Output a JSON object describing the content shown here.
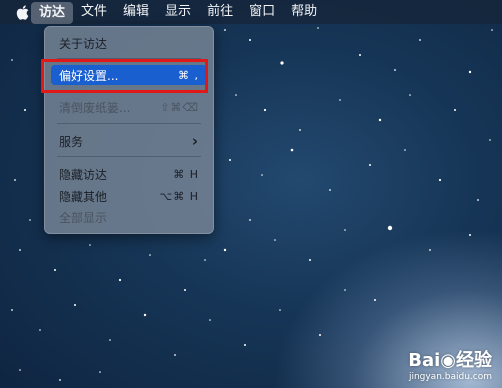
{
  "menubar": {
    "items": [
      "访达",
      "文件",
      "编辑",
      "显示",
      "前往",
      "窗口",
      "帮助"
    ],
    "active": "访达"
  },
  "menu": {
    "items": [
      {
        "label": "关于访达",
        "shortcut": "",
        "enabled": true
      },
      {
        "label": "偏好设置...",
        "shortcut": "⌘ ,",
        "enabled": true,
        "highlighted": true
      },
      {
        "label": "清倒废纸篓...",
        "shortcut": "⇧⌘⌫",
        "enabled": false
      },
      {
        "label": "服务",
        "shortcut": "›",
        "enabled": true,
        "submenu": true
      },
      {
        "label": "隐藏访达",
        "shortcut": "⌘ H",
        "enabled": true
      },
      {
        "label": "隐藏其他",
        "shortcut": "⌥⌘ H",
        "enabled": true
      },
      {
        "label": "全部显示",
        "shortcut": "",
        "enabled": false
      }
    ]
  },
  "watermark": {
    "logo": "Bai◉经验",
    "url": "jingyan.baidu.com"
  },
  "colors": {
    "highlight": "#1a5fd0",
    "annotation_box": "#e11818"
  }
}
